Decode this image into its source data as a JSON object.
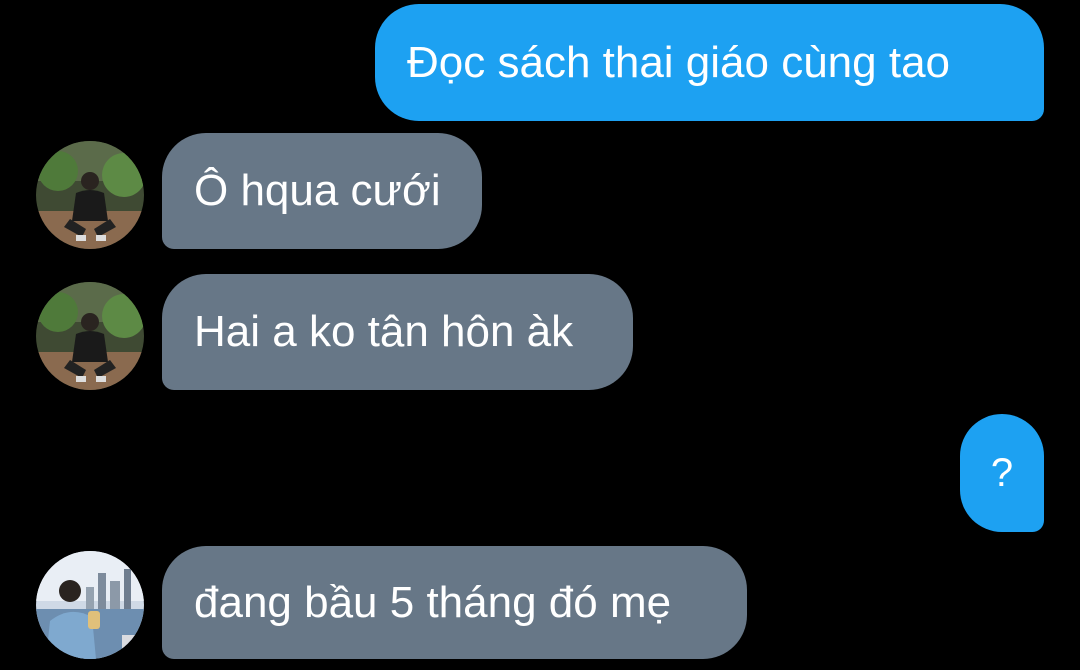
{
  "conversation": {
    "messages": [
      {
        "direction": "outgoing",
        "text": "Đọc sách thai giáo cùng tao"
      },
      {
        "direction": "incoming",
        "text": "Ô hqua cưới",
        "avatar": "user-photo-garden"
      },
      {
        "direction": "incoming",
        "text": "Hai a ko tân hôn àk",
        "avatar": "user-photo-garden"
      },
      {
        "direction": "outgoing",
        "text": "?"
      },
      {
        "direction": "incoming",
        "text": "đang bầu 5 tháng đó mẹ",
        "avatar": "user-photo-city"
      }
    ]
  },
  "colors": {
    "background": "#000000",
    "outgoing_bubble": "#1da1f2",
    "incoming_bubble": "#677787",
    "text": "#ffffff"
  }
}
